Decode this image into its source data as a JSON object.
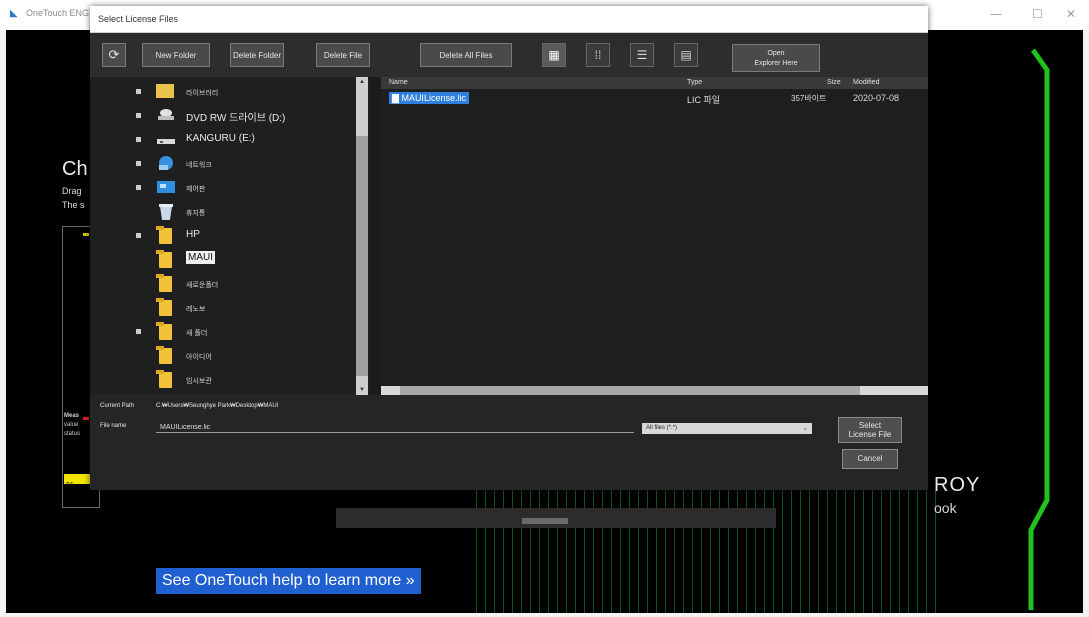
{
  "app": {
    "title": "OneTouch ENG",
    "minimize": "—",
    "maximize": "☐",
    "close": "✕"
  },
  "background": {
    "heading": "Ch",
    "line1": "Drag",
    "line2": "The s",
    "side_label1": "Meas",
    "side_label2": "value",
    "side_label3": "status",
    "side_label4": "01",
    "brand_line1": "ROY",
    "brand_line2": "ook",
    "help_link": "See OneTouch help to learn more »",
    "accent_color": "#1fc21f"
  },
  "dialog": {
    "title": "Select License Files",
    "toolbar": {
      "new_folder": "New Folder",
      "delete_folder": "Delete Folder",
      "delete_file": "Delete File",
      "delete_all_files": "Delete All Files",
      "open_explorer_line1": "Open",
      "open_explorer_line2": "Explorer Here"
    },
    "tree": [
      {
        "label": "라이브러리",
        "icon": "library-icon",
        "bullet": true
      },
      {
        "label": "DVD RW 드라이브 (D:)",
        "icon": "dvd-drive-icon",
        "bullet": true
      },
      {
        "label": "KANGURU (E:)",
        "icon": "usb-drive-icon",
        "bullet": true
      },
      {
        "label": "네트워크",
        "icon": "network-icon",
        "bullet": true
      },
      {
        "label": "제어판",
        "icon": "control-panel-icon",
        "bullet": true
      },
      {
        "label": "휴지통",
        "icon": "recycle-bin-icon",
        "bullet": false
      },
      {
        "label": "HP",
        "icon": "folder-icon",
        "bullet": true
      },
      {
        "label": "MAUI",
        "icon": "folder-icon",
        "bullet": false,
        "selected": true
      },
      {
        "label": "새로운폴더",
        "icon": "folder-icon",
        "bullet": false
      },
      {
        "label": "레노보",
        "icon": "folder-icon",
        "bullet": false
      },
      {
        "label": "새 폴더",
        "icon": "folder-icon",
        "bullet": true
      },
      {
        "label": "아이디어",
        "icon": "folder-icon",
        "bullet": false
      },
      {
        "label": "임시보관",
        "icon": "folder-icon",
        "bullet": false
      }
    ],
    "file_list": {
      "columns": {
        "name": "Name",
        "type": "Type",
        "size": "Size",
        "modified": "Modified"
      },
      "rows": [
        {
          "name": "MAUILicense.lic",
          "type": "LIC 파일",
          "size": "357바이트",
          "modified": "2020-07-08"
        }
      ]
    },
    "current_path_label": "Current Path",
    "current_path": "C:₩Users₩Seunghye Park₩Desktop₩MAUI",
    "file_name_label": "File name",
    "file_name_value": "MAUILicense.lic",
    "filter_value": "All files (*.*)",
    "select_button_line1": "Select",
    "select_button_line2": "License File",
    "cancel_button": "Cancel"
  }
}
